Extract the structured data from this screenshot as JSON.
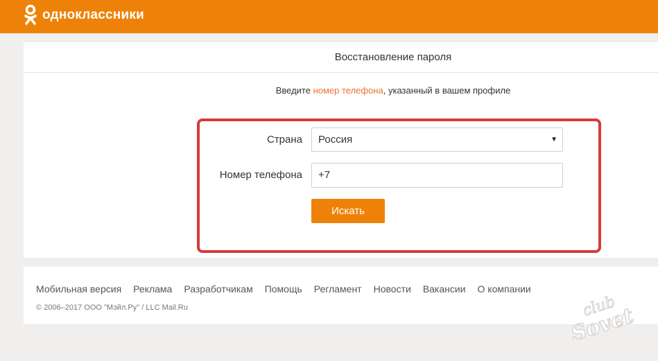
{
  "header": {
    "logo_text": "одноклассники",
    "brand_color": "#ee8208"
  },
  "page": {
    "title": "Восстановление пароля",
    "hint_before": "Введите ",
    "hint_link": "номер телефона",
    "hint_after": ", указанный в вашем профиле"
  },
  "form": {
    "country_label": "Страна",
    "country_value": "Россия",
    "phone_label": "Номер телефона",
    "phone_value": "+7",
    "submit_label": "Искать"
  },
  "footer": {
    "links": [
      "Мобильная версия",
      "Реклама",
      "Разработчикам",
      "Помощь",
      "Регламент",
      "Новости",
      "Вакансии",
      "О компании"
    ],
    "copyright": "© 2006–2017 ООО \"Мэйл.Ру\" / LLC Mail.Ru"
  },
  "watermark": {
    "line1": "club",
    "line2": "Sovet"
  },
  "colors": {
    "accent": "#ee8208",
    "link": "#eb722e",
    "highlight": "#d63b3b"
  }
}
